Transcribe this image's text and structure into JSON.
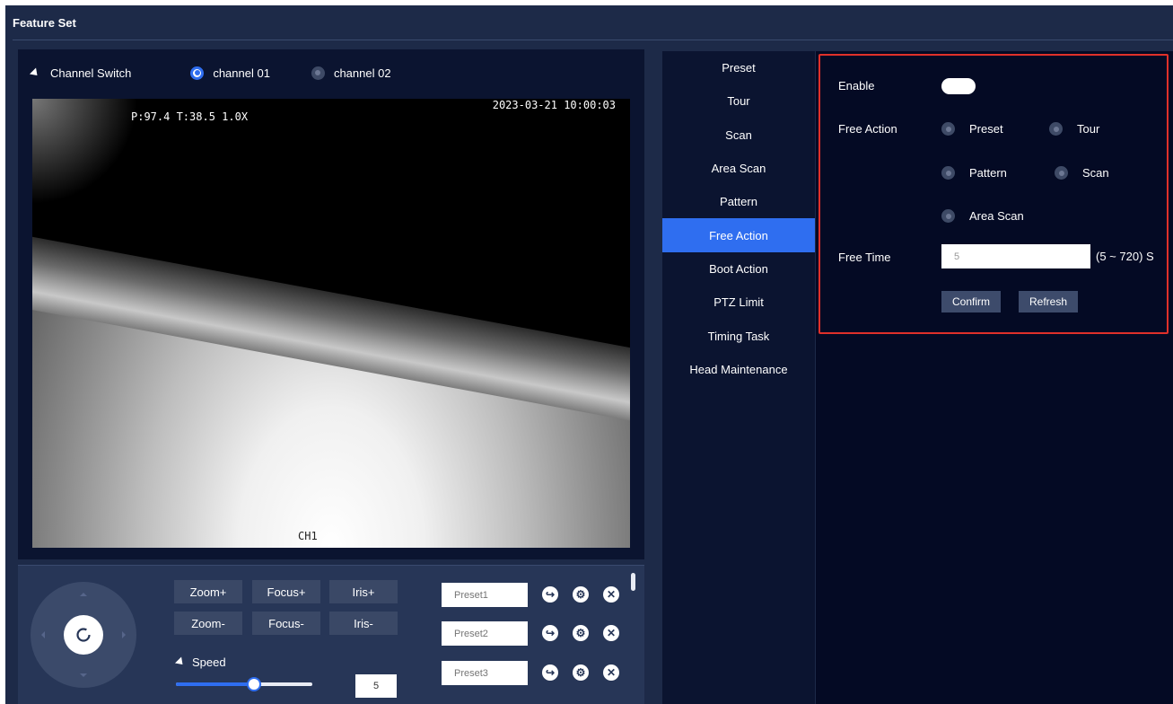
{
  "page": {
    "title": "Feature Set"
  },
  "channel_switch": {
    "label": "Channel Switch",
    "options": [
      {
        "label": "channel 01",
        "selected": true
      },
      {
        "label": "channel 02",
        "selected": false
      }
    ]
  },
  "video": {
    "ptz_overlay": "P:97.4 T:38.5 1.0X",
    "timestamp": "2023-03-21 10:00:03",
    "channel_tag": "CH1"
  },
  "ptz_controls": {
    "zoom_in": "Zoom+",
    "focus_in": "Focus+",
    "iris_in": "Iris+",
    "zoom_out": "Zoom-",
    "focus_out": "Focus-",
    "iris_out": "Iris-",
    "speed_label": "Speed",
    "speed_value": "5",
    "speed_fraction": 0.57
  },
  "presets": [
    {
      "placeholder": "Preset1"
    },
    {
      "placeholder": "Preset2"
    },
    {
      "placeholder": "Preset3"
    }
  ],
  "menu": {
    "items": [
      {
        "label": "Preset"
      },
      {
        "label": "Tour"
      },
      {
        "label": "Scan"
      },
      {
        "label": "Area Scan"
      },
      {
        "label": "Pattern"
      },
      {
        "label": "Free Action",
        "active": true
      },
      {
        "label": "Boot Action"
      },
      {
        "label": "PTZ Limit"
      },
      {
        "label": "Timing Task"
      },
      {
        "label": "Head Maintenance"
      }
    ]
  },
  "free_action": {
    "enable_label": "Enable",
    "enabled": false,
    "action_label": "Free Action",
    "options": {
      "preset": "Preset",
      "tour": "Tour",
      "pattern": "Pattern",
      "scan": "Scan",
      "area_scan": "Area Scan"
    },
    "time_label": "Free Time",
    "time_value": "5",
    "time_range": "(5 ~ 720) S",
    "confirm": "Confirm",
    "refresh": "Refresh"
  },
  "colors": {
    "accent": "#2f6ef0",
    "highlight_border": "#e0302a",
    "panel_bg": "#1d2a48"
  }
}
